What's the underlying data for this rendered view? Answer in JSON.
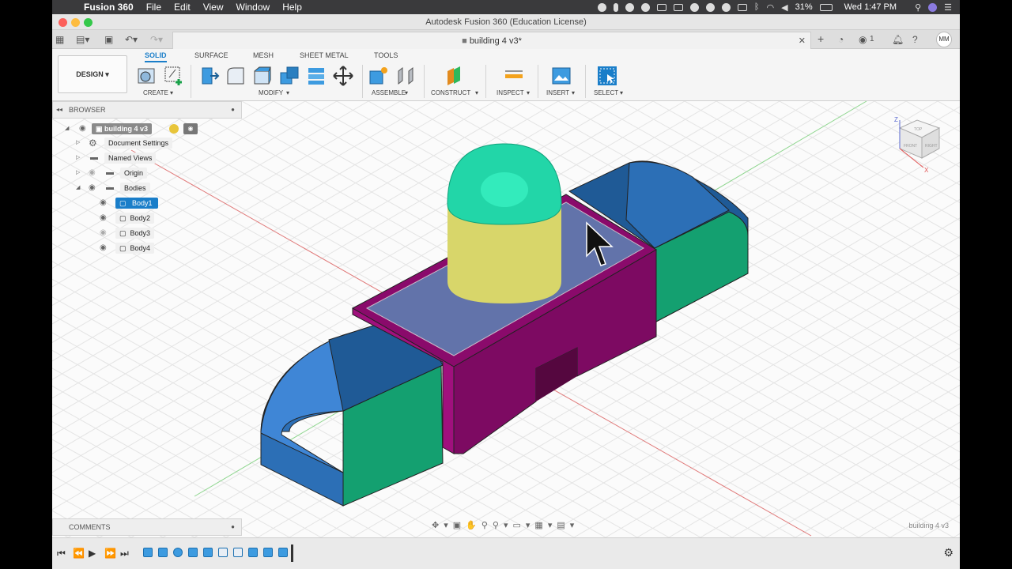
{
  "menubar": {
    "app_name": "Fusion 360",
    "items": [
      "File",
      "Edit",
      "View",
      "Window",
      "Help"
    ],
    "battery": "31%",
    "clock": "Wed 1:47 PM"
  },
  "window": {
    "title": "Autodesk Fusion 360 (Education License)",
    "doc_tab": "building 4 v3*",
    "job_count": "1",
    "user_initials": "MM"
  },
  "ribbon": {
    "workspace": "DESIGN",
    "tabs": [
      "SOLID",
      "SURFACE",
      "MESH",
      "SHEET METAL",
      "TOOLS"
    ],
    "groups": [
      "CREATE",
      "MODIFY",
      "ASSEMBLE",
      "CONSTRUCT",
      "INSPECT",
      "INSERT",
      "SELECT"
    ]
  },
  "browser": {
    "title": "BROWSER",
    "root": "building 4 v3",
    "items": [
      "Document Settings",
      "Named Views",
      "Origin",
      "Bodies"
    ],
    "bodies": [
      "Body1",
      "Body2",
      "Body3",
      "Body4"
    ]
  },
  "comments": {
    "title": "COMMENTS"
  },
  "viewport": {
    "watermark": "building 4 v3",
    "viewcube": {
      "top": "TOP",
      "front": "FRONT",
      "right": "RIGHT",
      "z": "Z",
      "x": "X"
    }
  },
  "colors": {
    "accent": "#1a7ec9",
    "body_blue": "#2c6fb6",
    "body_green": "#14a070",
    "body_magenta": "#8a0a6b",
    "body_yellow": "#e2e07a",
    "body_teal": "#22d6a8"
  }
}
